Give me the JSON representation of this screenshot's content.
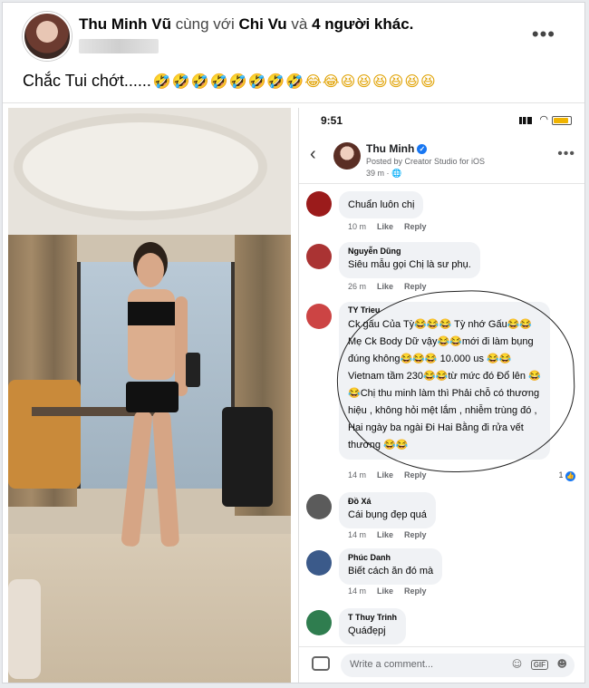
{
  "post": {
    "author": "Thu Minh Vũ",
    "with_word": "cùng với",
    "tagged": "Chi Vu",
    "and_word": "và",
    "others": "4 người khác.",
    "more_label": "•••",
    "caption": "Chắc Tui chớt......",
    "caption_emojis": "🤣🤣🤣🤣🤣🤣🤣🤣😂😂😆😆😆😆😆😆"
  },
  "phone": {
    "clock": "9:51",
    "page_name": "Thu Minh",
    "page_subtitle": "Posted by Creator Studio for iOS",
    "page_time": "39 m",
    "back_label": "‹",
    "more_label": "•••",
    "comments": [
      {
        "name": "",
        "text": "Chuẩn luôn chị",
        "time": "10 m",
        "like": "Like",
        "reply": "Reply"
      },
      {
        "name": "Nguyễn Dũng",
        "text": "Siêu mẫu gọi Chị là sư phụ.",
        "time": "26 m",
        "like": "Like",
        "reply": "Reply"
      },
      {
        "name": "TY Trieu",
        "lines": [
          "Ck gấu  Của Tỳ😂😂😂 Tỳ nhớ Gấu😂😂",
          "Mẹ Ck Body Dữ vậy😂😂mới đi làm bụng",
          "đúng không😂😂😂 10.000 us 😂😂",
          "Vietnam tầm 230😂😂từ mức đó Đổ lên 😂",
          "😂Chị thu minh làm thì Phải chỗ có thương",
          "hiệu , không hỏi mệt lắm , nhiễm trùng đó ,",
          "Hai ngày ba ngài Đi Hai Bằng đi rửa vết",
          "thương 😂😂"
        ],
        "time": "14 m",
        "like": "Like",
        "reply": "Reply",
        "reply_count": "1"
      },
      {
        "name": "Đồ Xá",
        "text": "Cái bụng đẹp quá",
        "time": "14 m",
        "like": "Like",
        "reply": "Reply"
      },
      {
        "name": "Phúc Danh",
        "text": "Biết cách ăn đó mà",
        "time": "14 m",
        "like": "Like",
        "reply": "Reply"
      },
      {
        "name": "T Thuy Trinh",
        "text": "Quáđẹpj"
      }
    ],
    "composer_placeholder": "Write a comment...",
    "gif_label": "GIF"
  },
  "colors": {
    "accent": "#1877f2",
    "bubble": "#f0f2f5",
    "emoji": "#e0a100"
  }
}
